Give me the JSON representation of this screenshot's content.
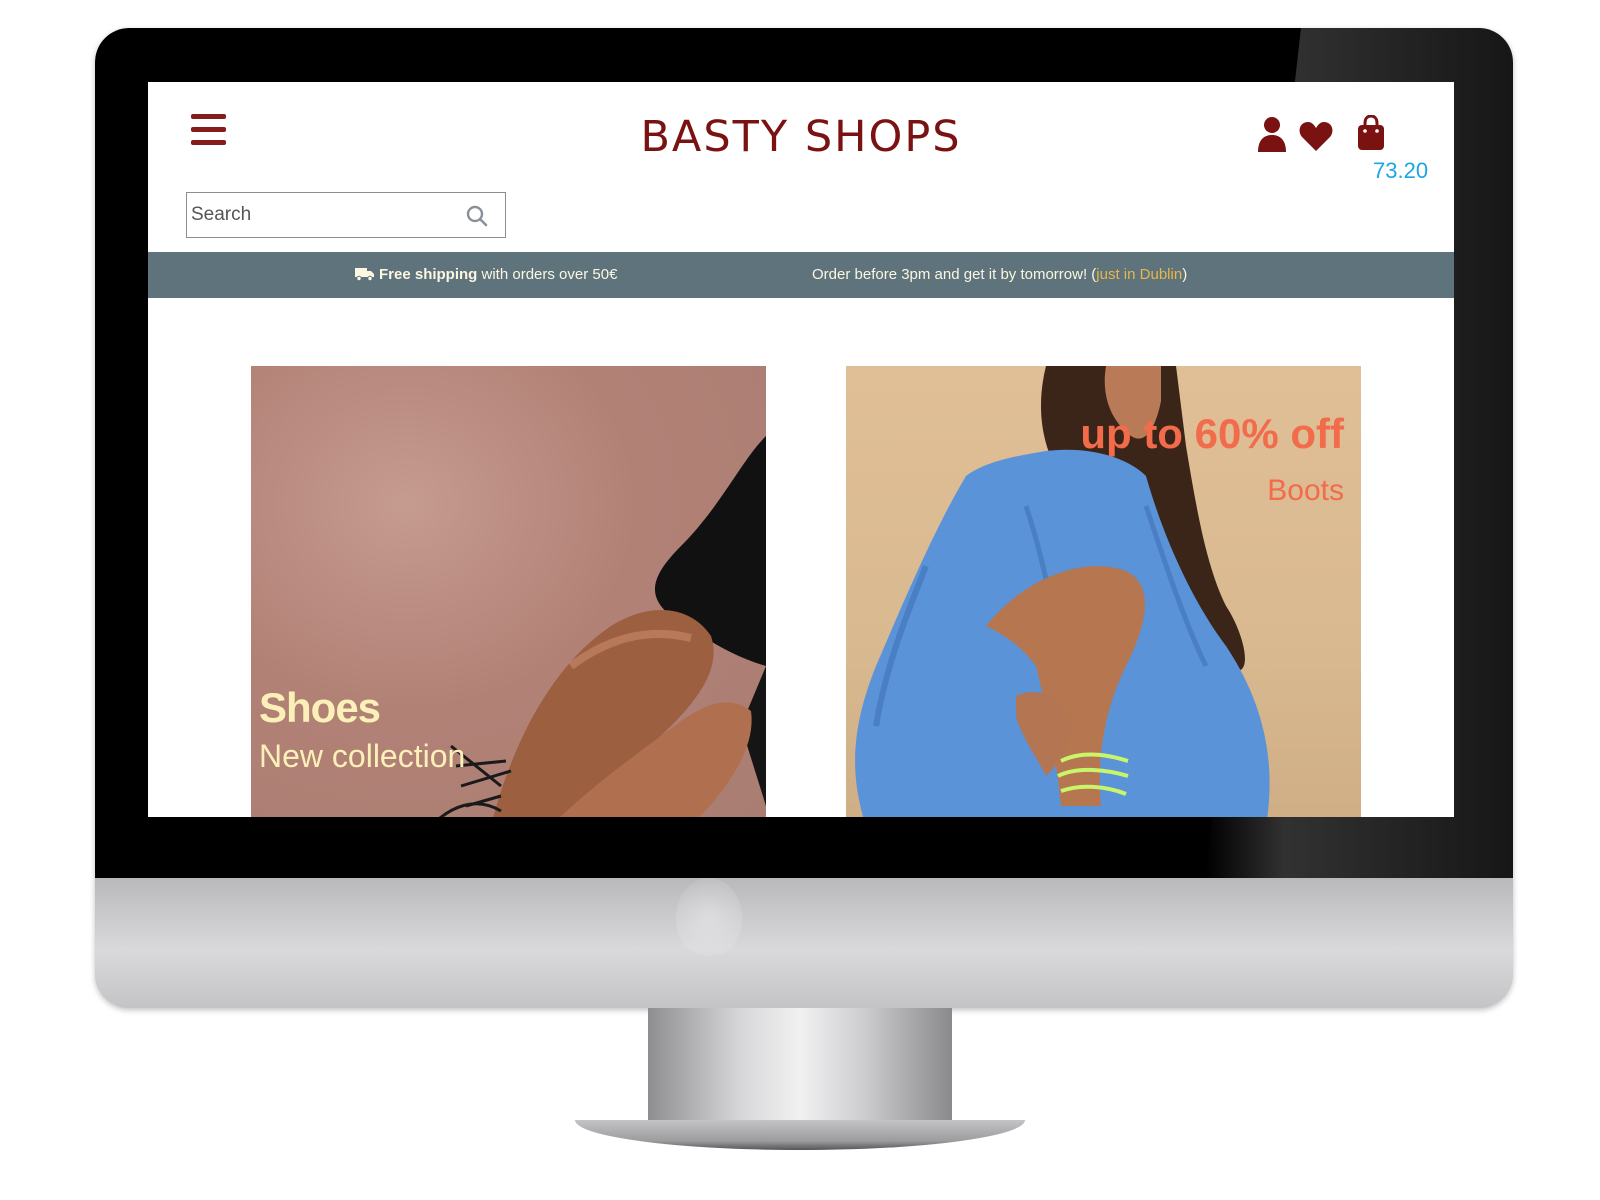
{
  "shop": {
    "name": "BASTY SHOPS",
    "cart_total": "73.20"
  },
  "search": {
    "placeholder": "Search"
  },
  "promo": {
    "free_shipping_bold": "Free shipping",
    "free_shipping_rest": " with orders over 50€",
    "order_text": "Order before 3pm and get it by tomorrow! (",
    "order_highlight": "just in Dublin",
    "order_close": ")"
  },
  "banners": {
    "shoes": {
      "title": "Shoes",
      "subtitle": "New collection"
    },
    "boots": {
      "title": "up to 60% off",
      "subtitle": "Boots"
    }
  },
  "colors": {
    "brand": "#7a1212",
    "accent_price": "#1aa6e5",
    "promo_bar": "#5e737c",
    "promo_highlight": "#e7b84a",
    "shoes_text": "#fbf1b8",
    "boots_text": "#f26b4a"
  },
  "icons": [
    "hamburger-icon",
    "search-icon",
    "user-icon",
    "heart-icon",
    "shopping-bag-icon",
    "truck-icon"
  ]
}
